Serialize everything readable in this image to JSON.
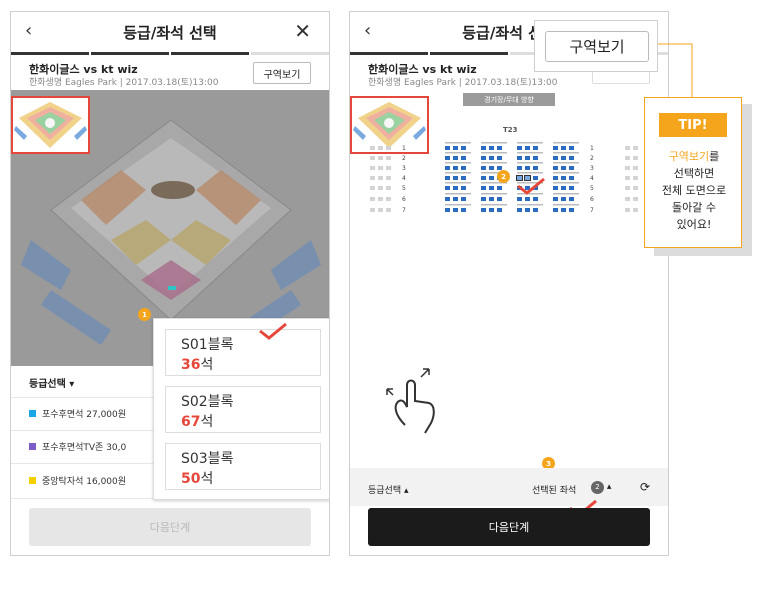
{
  "screen1": {
    "title": "등급/좌석 선택",
    "back_icon": "‹",
    "close_icon": "✕",
    "match_title": "한화이글스 vs kt wiz",
    "match_sub": "한화생명 Eagles Park  |  2017.03.18(토)13:00",
    "zone_button": "구역보기",
    "legend_header": "등급선택  ▾",
    "legend": [
      {
        "label": "포수후면석   27,000원",
        "color": "#1aa7e8"
      },
      {
        "label": "포수후면석TV존   30,0",
        "color": "#7b5cc8"
      },
      {
        "label": "중앙탁자석   16,000원",
        "color": "#f5d000"
      }
    ],
    "next_button": "다음단계",
    "badge": "1",
    "blocks": [
      {
        "name": "S01블록",
        "count": "36",
        "unit": "석"
      },
      {
        "name": "S02블록",
        "count": "67",
        "unit": "석"
      },
      {
        "name": "S03블록",
        "count": "50",
        "unit": "석"
      }
    ]
  },
  "screen2": {
    "title": "등급/좌석 선택",
    "back_icon": "‹",
    "match_title": "한화이글스 vs kt wiz",
    "match_sub": "한화생명 Eagles Park  |  2017.03.18(토)13:00",
    "gate_label": "경기장/무대 방향",
    "block_label": "T23",
    "row_numbers": [
      "1",
      "2",
      "3",
      "4",
      "5",
      "6",
      "7"
    ],
    "badge2": "2",
    "badge3": "3",
    "bottom_grade": "등급선택  ▴",
    "selected_label": "선택된 좌석",
    "selected_count": "2",
    "next_button": "다음단계"
  },
  "zone_callout": "구역보기",
  "tip": {
    "label": "TIP!",
    "highlight": "구역보기",
    "text1": "를",
    "text2": "선택하면",
    "text3": "전체 도면으로",
    "text4": "돌아갈 수",
    "text5": "있어요!"
  },
  "colors": {
    "accent": "#f4a51c",
    "check_red": "#e5483b",
    "seat_blue": "#2c6cc0",
    "dark_button": "#1b1b1b"
  }
}
